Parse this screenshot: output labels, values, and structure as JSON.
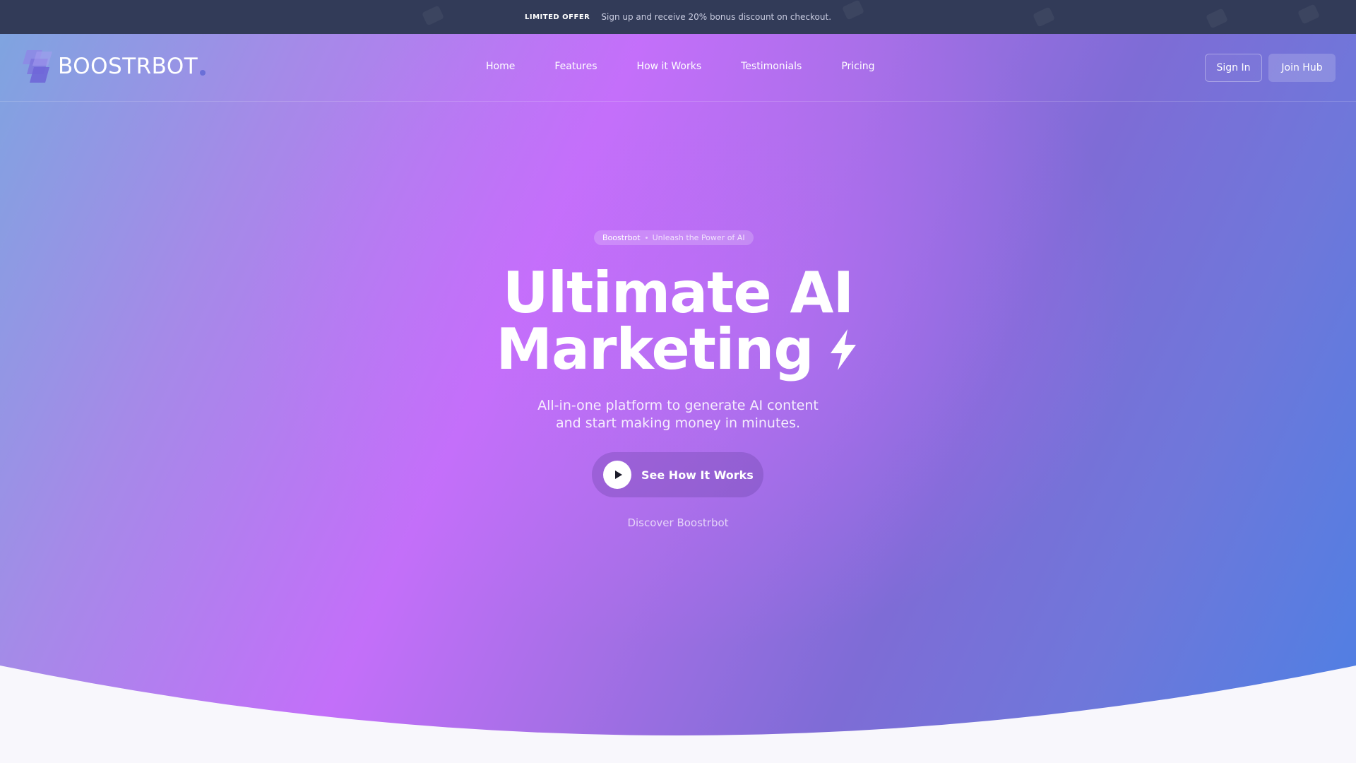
{
  "offer_bar": {
    "tag": "LIMITED OFFER",
    "text": "Sign up and receive 20% bonus discount on checkout."
  },
  "brand": {
    "name": "BOOSTRBOT"
  },
  "nav": {
    "links": [
      {
        "label": "Home"
      },
      {
        "label": "Features"
      },
      {
        "label": "How it Works"
      },
      {
        "label": "Testimonials"
      },
      {
        "label": "Pricing"
      }
    ],
    "sign_in": "Sign In",
    "join": "Join Hub"
  },
  "hero": {
    "pill_brand": "Boostrbot",
    "pill_tagline": "Unleash the Power of AI",
    "headline_line1": "Ultimate AI",
    "headline_line2": "Marketing",
    "subtitle_line1": "All-in-one platform to generate AI content",
    "subtitle_line2": "and start making money in minutes.",
    "cta_label": "See How It Works",
    "discover": "Discover Boostrbot"
  },
  "colors": {
    "offer_bar_bg": "#323b58",
    "gradient_left": "#7fa4e0",
    "gradient_mid": "#c36ff9",
    "gradient_right": "#4d80e4",
    "curve_fill": "#f8f7fc"
  },
  "icons": {
    "logo": "stacked-parallelograms-logo-icon",
    "headline": "lightning-bolt-icon",
    "cta": "play-icon"
  }
}
